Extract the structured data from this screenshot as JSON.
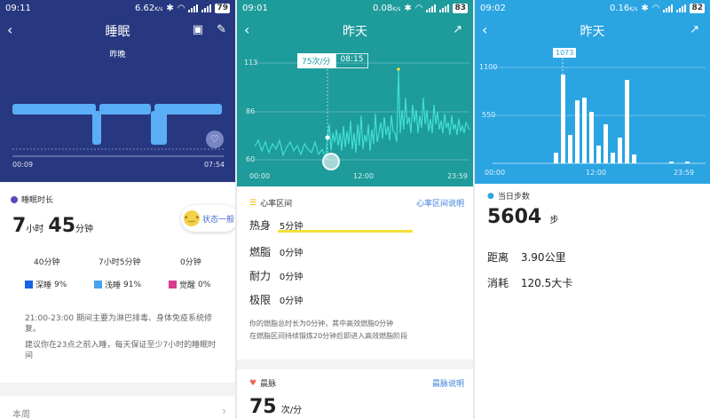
{
  "panel1": {
    "status": {
      "time": "09:11",
      "net": "6.62",
      "net_unit": "K/s",
      "battery": "79"
    },
    "title": "睡眠",
    "subtitle": "昨晚",
    "chart": {
      "start": "00:09",
      "end": "07:54"
    },
    "section_title": "睡眠时长",
    "duration": {
      "h": "7",
      "h_unit": "小时",
      "m": "45",
      "m_unit": "分钟"
    },
    "mood": "状态一般",
    "stats": [
      {
        "value": "40分钟",
        "label": "深睡",
        "pct": "9%",
        "color": "#1565e6"
      },
      {
        "value": "7小时5分钟",
        "label": "浅睡",
        "pct": "91%",
        "color": "#4aa3f0"
      },
      {
        "value": "0分钟",
        "label": "觉醒",
        "pct": "0%",
        "color": "#d63c8f"
      }
    ],
    "note1": "21:00-23:00 期间主要为淋巴排毒、身体免疫系统修复。",
    "note2": "建议你在23点之前入睡，每天保证至少7小时的睡眠时间",
    "footer": "本周",
    "colors": {
      "header": "#273880",
      "bar": "#5aaef5"
    }
  },
  "panel2": {
    "status": {
      "time": "09:01",
      "net": "0.08",
      "net_unit": "K/s",
      "battery": "83"
    },
    "title": "昨天",
    "chart": {
      "y_ticks": [
        "113",
        "86",
        "60"
      ],
      "x_ticks": [
        "00:00",
        "12:00",
        "23:59"
      ],
      "tooltip_value": "75次/分",
      "tooltip_time": "08:15"
    },
    "zones_title": "心率区间",
    "zones_link": "心率区间说明",
    "zones": [
      {
        "name": "热身",
        "value": "5分钟"
      },
      {
        "name": "燃脂",
        "value": "0分钟"
      },
      {
        "name": "耐力",
        "value": "0分钟"
      },
      {
        "name": "极限",
        "value": "0分钟"
      }
    ],
    "note1": "你的燃脂总时长为0分钟，其中高效燃脂0分钟",
    "note2": "在燃脂区间持续锻炼20分钟后即进入高效燃脂阶段",
    "morning_title": "晨脉",
    "morning_link": "晨脉说明",
    "morning_value": "75",
    "morning_unit": "次/分",
    "colors": {
      "header": "#1e9b9b",
      "line": "#41e0d2",
      "bar": "#f4e03a"
    }
  },
  "panel3": {
    "status": {
      "time": "09:02",
      "net": "0.16",
      "net_unit": "K/s",
      "battery": "82"
    },
    "title": "昨天",
    "chart": {
      "y_ticks": [
        "1100",
        "550"
      ],
      "x_ticks": [
        "00:00",
        "12:00",
        "23:59"
      ],
      "tooltip": "1073"
    },
    "section_title": "当日步数",
    "steps": "5604",
    "steps_unit": "步",
    "distance_label": "距离",
    "distance_value": "3.90公里",
    "calorie_label": "消耗",
    "calorie_value": "120.5大卡",
    "colors": {
      "header": "#2ba4e2"
    }
  }
}
